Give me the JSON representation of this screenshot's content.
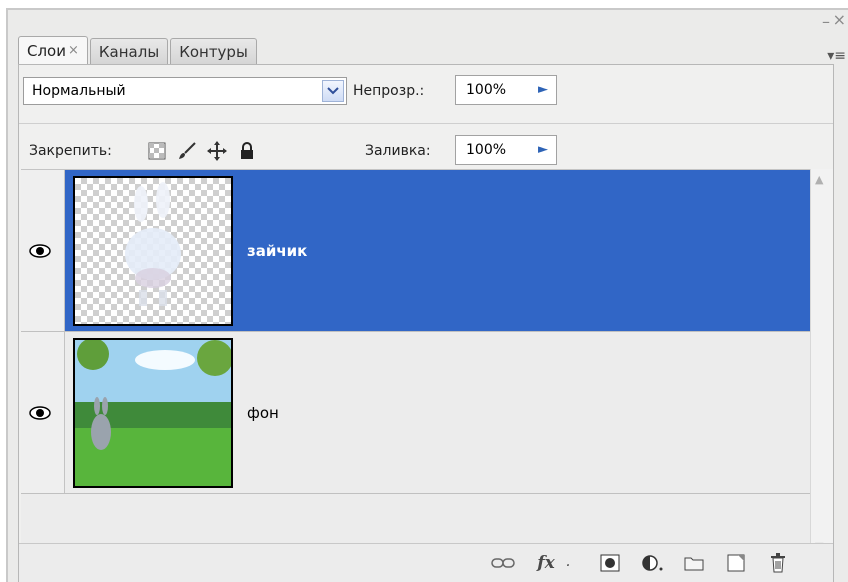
{
  "tabs": [
    {
      "label": "Слои",
      "close": "×"
    },
    {
      "label": "Каналы"
    },
    {
      "label": "Контуры"
    }
  ],
  "window": {
    "minimize": "–",
    "close": "×",
    "menu": "▾≡"
  },
  "blend_mode": {
    "value": "Нормальный"
  },
  "opacity": {
    "label": "Непрозр.:",
    "value": "100%"
  },
  "lock": {
    "label": "Закрепить:"
  },
  "fill": {
    "label": "Заливка:",
    "value": "100%"
  },
  "layers": [
    {
      "name": "зайчик",
      "selected": true,
      "visible": true
    },
    {
      "name": "фон",
      "selected": false,
      "visible": true
    }
  ],
  "colors": {
    "selection": "#3166c6",
    "panel": "#ebebea",
    "accent": "#2e63b6"
  },
  "bottom_icons": [
    "link-icon",
    "fx-icon",
    "mask-icon",
    "adjustment-icon",
    "folder-icon",
    "new-layer-icon",
    "trash-icon"
  ],
  "fx_label": "fx"
}
